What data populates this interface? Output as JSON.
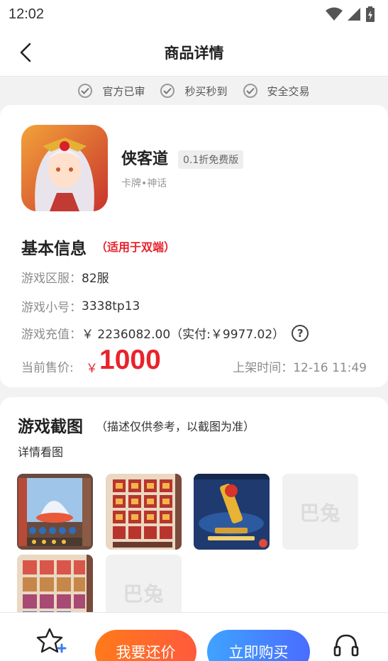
{
  "status_bar": {
    "time": "12:02"
  },
  "header": {
    "title": "商品详情"
  },
  "guarantees": [
    "官方已审",
    "秒买秒到",
    "安全交易"
  ],
  "game": {
    "name": "侠客道",
    "version_tag": "0.1折免费版",
    "tags": "卡牌•神话"
  },
  "basic_info": {
    "title": "基本信息",
    "note": "（适用于双端）",
    "rows": [
      {
        "label": "游戏区服：",
        "value": "82服"
      },
      {
        "label": "游戏小号：",
        "value": "3338tp13"
      },
      {
        "label": "游戏充值：",
        "value": "￥ 2236082.00（实付:￥9977.02）"
      }
    ],
    "help_icon": "?",
    "price_label": "当前售价:",
    "price_currency": "￥",
    "price_value": "1000",
    "listed_time": "上架时间：12-16 11:49"
  },
  "screenshots": {
    "title": "游戏截图",
    "note": "（描述仅供参考，以截图为准）",
    "sub": "详情看图",
    "placeholder_logo": "巴兔"
  },
  "bottom": {
    "counter_offer": "我要还价",
    "buy_now": "立即购买"
  },
  "icons": {
    "back": "chevron-left-icon",
    "favorite": "star-plus-icon",
    "service": "headset-icon",
    "check": "check-circle-icon",
    "help": "question-circle-icon"
  },
  "colors": {
    "price_red": "#e8232c",
    "counter_orange": "#ff6a2c",
    "buy_blue": "#4a86ff"
  }
}
